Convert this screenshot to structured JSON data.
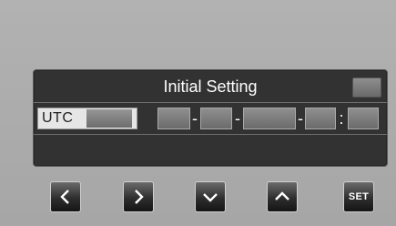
{
  "dialog": {
    "title": "Initial Setting"
  },
  "utc": {
    "label": "UTC"
  },
  "datetime": {
    "separators": [
      "-",
      "-",
      "-",
      ":"
    ]
  },
  "buttons": {
    "left_icon": "chevron-left-icon",
    "right_icon": "chevron-right-icon",
    "down_icon": "chevron-down-icon",
    "up_icon": "chevron-up-icon",
    "set_label": "SET"
  },
  "colors": {
    "background": "#a9a9a9",
    "panel": "#323232",
    "text": "#ffffff"
  }
}
